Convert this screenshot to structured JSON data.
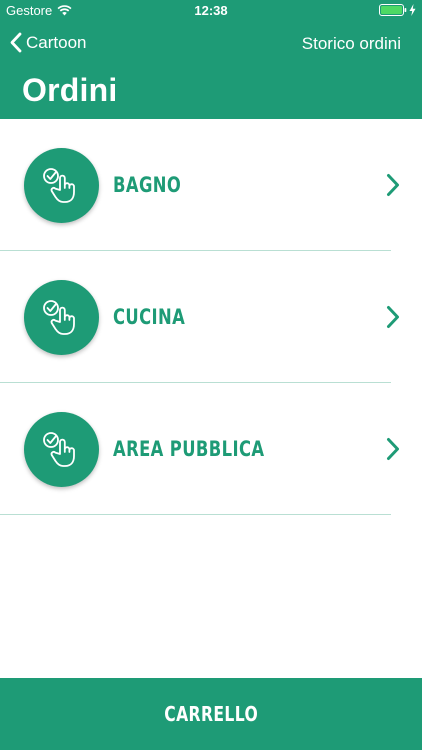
{
  "status_bar": {
    "carrier": "Gestore",
    "time": "12:38"
  },
  "nav": {
    "back_label": "Cartoon",
    "right_label": "Storico ordini"
  },
  "page_title": "Ordini",
  "items": [
    {
      "label": "BAGNO",
      "icon": "tap-check-icon"
    },
    {
      "label": "CUCINA",
      "icon": "tap-check-icon"
    },
    {
      "label": "AREA PUBBLICA",
      "icon": "tap-check-icon"
    }
  ],
  "bottom": {
    "label": "CARRELLO"
  },
  "colors": {
    "brand_green": "#1e9b76",
    "divider": "#b9dfd3",
    "battery_fill": "#4cd964"
  }
}
